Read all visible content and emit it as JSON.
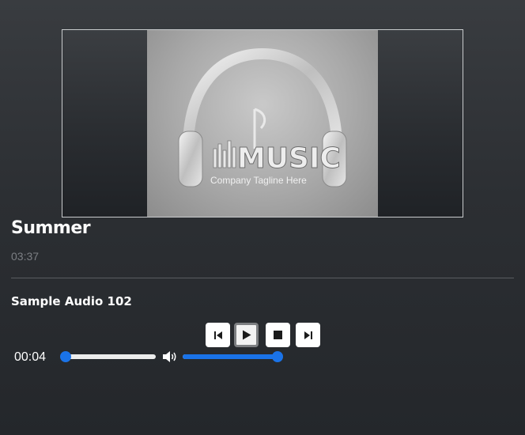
{
  "cover": {
    "logo_text": "MUSIC",
    "tagline": "Company Tagline Here"
  },
  "track": {
    "title": "Summer",
    "duration": "03:37"
  },
  "player": {
    "now_playing": "Sample Audio 102",
    "current_time": "00:04",
    "progress_fraction": 0.05,
    "volume_fraction": 1.0
  },
  "icons": {
    "previous": "skip-previous-icon",
    "play": "play-icon",
    "stop": "stop-icon",
    "next": "skip-next-icon",
    "volume": "volume-icon"
  },
  "colors": {
    "accent": "#1a73e8",
    "background": "#2c2f33",
    "muted_text": "#7c7f84"
  }
}
